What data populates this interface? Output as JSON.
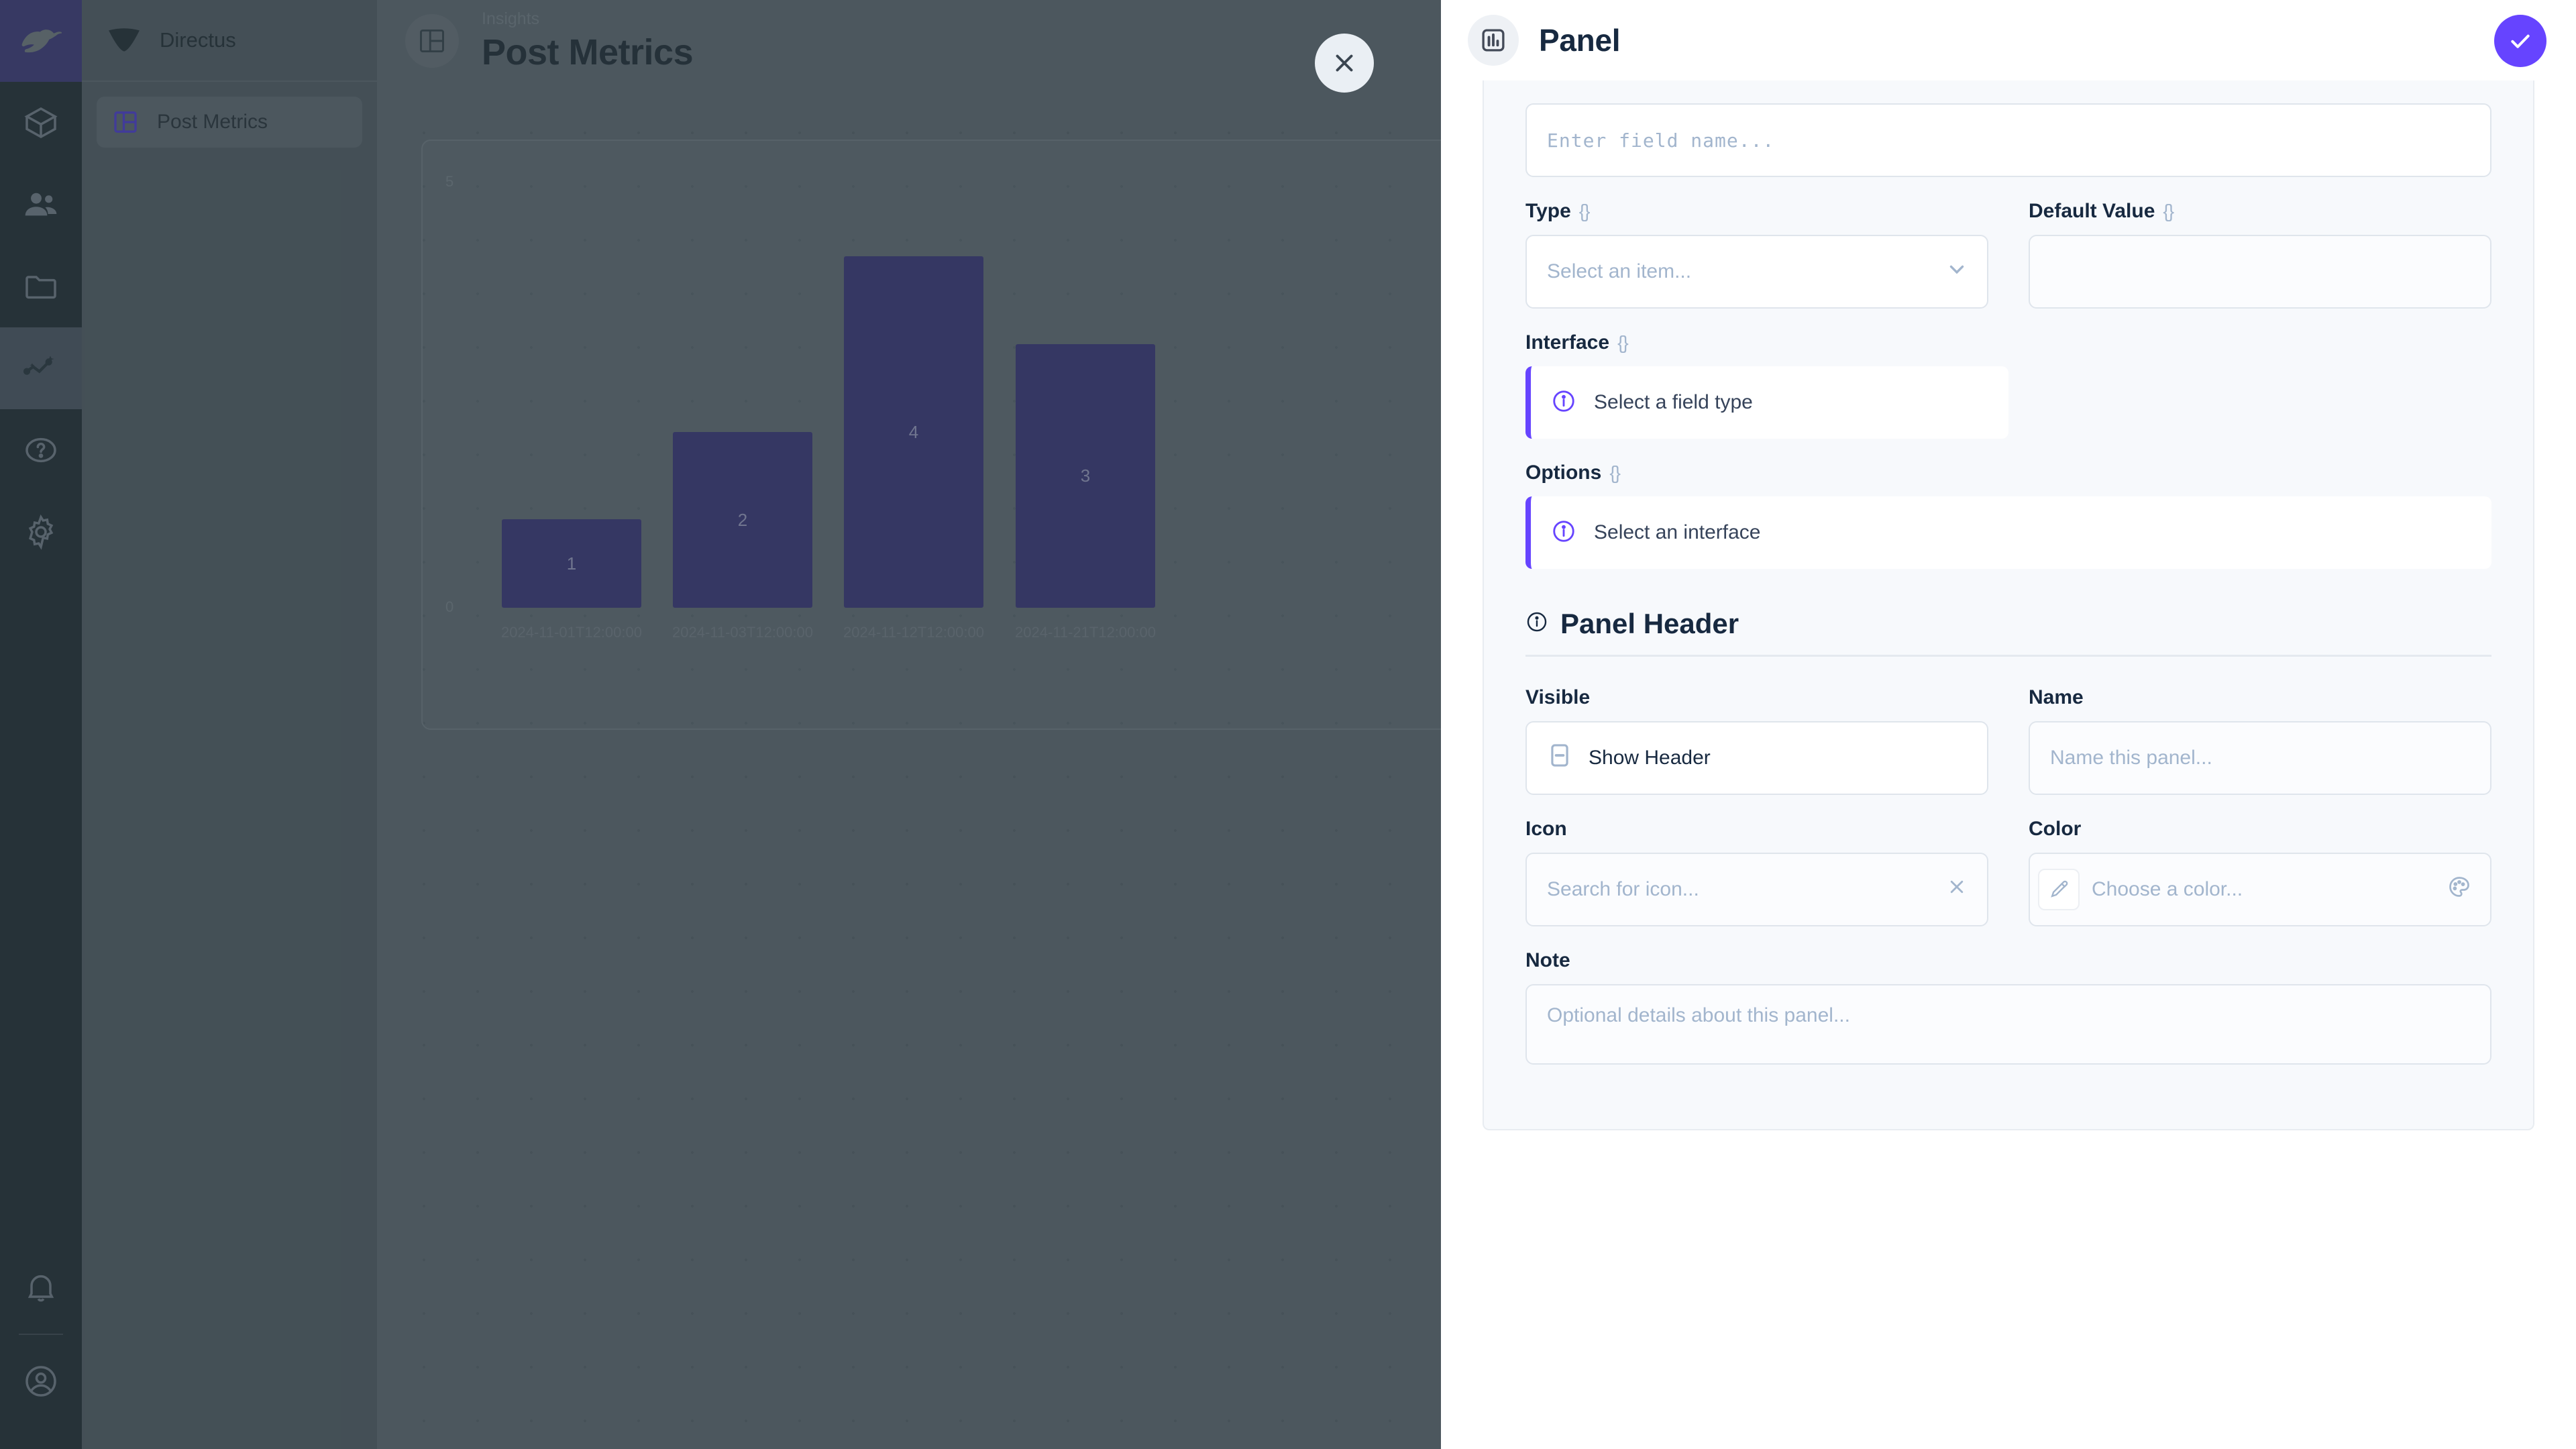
{
  "module_bar": {
    "logo": {
      "name": "directus-rabbit-logo"
    },
    "items": [
      {
        "icon": "box-icon",
        "label": "Content",
        "active": false
      },
      {
        "icon": "people-icon",
        "label": "User Directory",
        "active": false
      },
      {
        "icon": "folder-icon",
        "label": "File Library",
        "active": false
      },
      {
        "icon": "insights-icon",
        "label": "Insights",
        "active": true
      },
      {
        "icon": "help-icon",
        "label": "Help",
        "active": false
      },
      {
        "icon": "gear-icon",
        "label": "Settings",
        "active": false
      }
    ],
    "bottom": [
      {
        "icon": "bell-icon",
        "label": "Notifications"
      },
      {
        "icon": "account-circle-icon",
        "label": "Account"
      }
    ]
  },
  "nav_sidebar": {
    "project_name": "Directus",
    "items": [
      {
        "label": "Post Metrics",
        "icon": "dashboard-icon",
        "active": true
      }
    ]
  },
  "main": {
    "breadcrumb": "Insights",
    "title": "Post Metrics",
    "header_icon": "dashboard-icon",
    "close_button": "close-icon"
  },
  "chart_data": {
    "type": "bar",
    "title": "",
    "xlabel": "",
    "ylabel": "",
    "categories": [
      "2024-11-01T12:00:00",
      "2024-11-03T12:00:00",
      "2024-11-12T12:00:00",
      "2024-11-21T12:00:00"
    ],
    "values": [
      1,
      2,
      4,
      3
    ],
    "ylim": [
      0,
      5
    ],
    "ytick_labels": [
      "0",
      "5"
    ],
    "grid": false,
    "legend": "none",
    "bar_color": "#3b3a73",
    "data_labels": [
      "1",
      "2",
      "4",
      "3"
    ]
  },
  "drawer": {
    "header": {
      "icon": "bar-chart-icon",
      "title": "Panel",
      "save_button": "check-icon"
    },
    "field_name": {
      "label": "",
      "placeholder": "Enter field name...",
      "value": ""
    },
    "type": {
      "label": "Type",
      "braces": "{}",
      "placeholder": "Select an item...",
      "value": "",
      "chevron": "chevron-down-icon"
    },
    "default_value": {
      "label": "Default Value",
      "braces": "{}",
      "placeholder": "",
      "value": ""
    },
    "interface": {
      "label": "Interface",
      "braces": "{}",
      "notice": "Select a field type",
      "notice_icon": "info-icon"
    },
    "options": {
      "label": "Options",
      "braces": "{}",
      "notice": "Select an interface",
      "notice_icon": "info-icon"
    },
    "panel_header_section": {
      "title": "Panel Header",
      "icon": "info-icon"
    },
    "visible": {
      "label": "Visible",
      "checkbox_label": "Show Header",
      "checkbox_state": "indeterminate"
    },
    "name": {
      "label": "Name",
      "placeholder": "Name this panel...",
      "value": ""
    },
    "icon": {
      "label": "Icon",
      "placeholder": "Search for icon...",
      "value": "",
      "clear_icon": "close-icon"
    },
    "color": {
      "label": "Color",
      "placeholder": "Choose a color...",
      "value": "",
      "eyedropper_icon": "eyedropper-icon",
      "palette_icon": "palette-icon"
    },
    "note": {
      "label": "Note",
      "placeholder": "Optional details about this panel...",
      "value": ""
    }
  },
  "colors": {
    "accent": "#6644ff",
    "bar": "#3b3a73",
    "text_dark": "#172940",
    "placeholder": "#a2b5cd",
    "module_bar": "#263238"
  }
}
